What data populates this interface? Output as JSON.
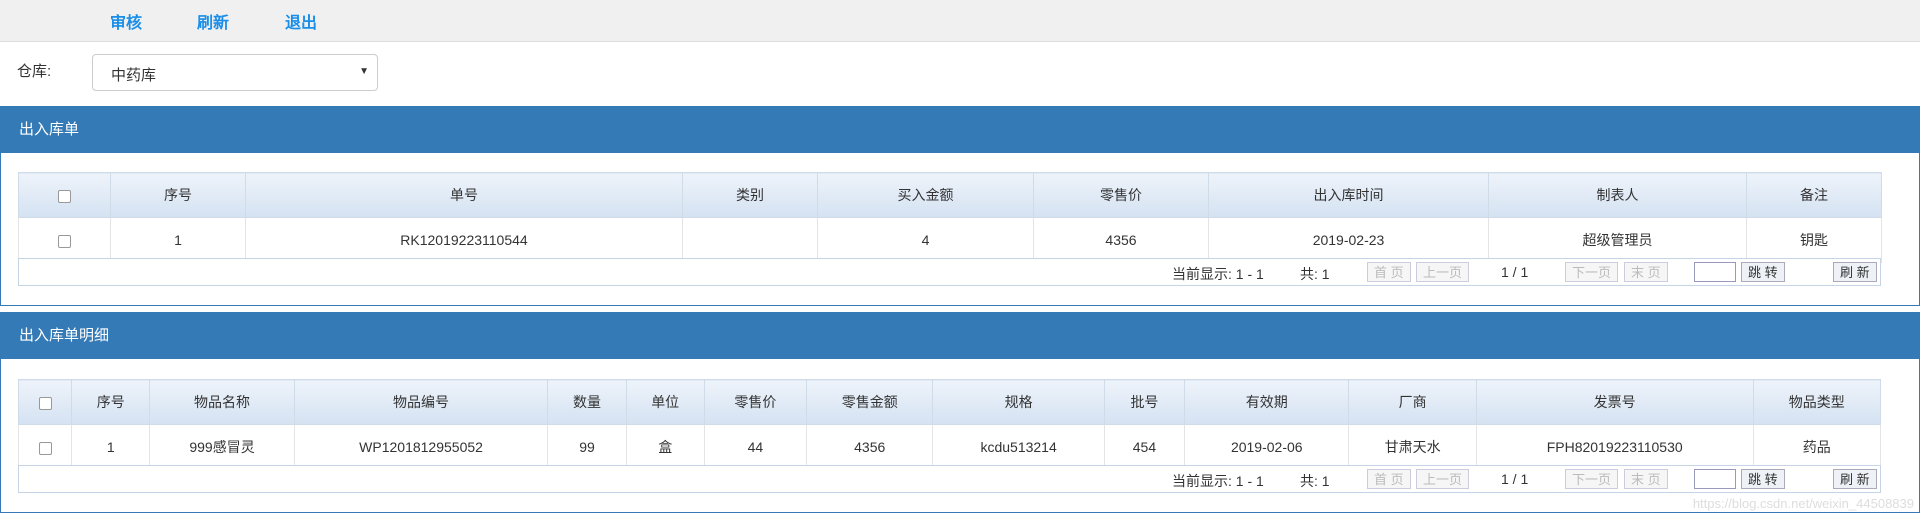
{
  "toolbar": {
    "audit": "审核",
    "refresh": "刷新",
    "exit": "退出"
  },
  "warehouse": {
    "label": "仓库:",
    "selected": "中药库"
  },
  "panel1": {
    "title": "出入库单",
    "headers": [
      "序号",
      "单号",
      "类别",
      "买入金额",
      "零售价",
      "出入库时间",
      "制表人",
      "备注"
    ],
    "row": {
      "index": "1",
      "order_no": "RK12019223110544",
      "category": "",
      "buy_amount": "4",
      "retail_price": "4356",
      "time": "2019-02-23",
      "maker": "超级管理员",
      "note": "钥匙"
    },
    "pager": {
      "showing": "当前显示: 1 - 1",
      "total": "共: 1",
      "first": "首 页",
      "prev": "上一页",
      "page": "1 / 1",
      "next": "下一页",
      "last": "末 页",
      "jump": "跳 转",
      "refresh": "刷 新"
    }
  },
  "panel2": {
    "title": "出入库单明细",
    "headers": [
      "序号",
      "物品名称",
      "物品编号",
      "数量",
      "单位",
      "零售价",
      "零售金额",
      "规格",
      "批号",
      "有效期",
      "厂商",
      "发票号",
      "物品类型"
    ],
    "row": {
      "index": "1",
      "name": "999感冒灵",
      "code": "WP1201812955052",
      "qty": "99",
      "unit": "盒",
      "retail_price": "44",
      "retail_amount": "4356",
      "spec": "kcdu513214",
      "batch": "454",
      "expiry": "2019-02-06",
      "maker": "甘肃天水",
      "invoice": "FPH82019223110530",
      "type": "药品"
    },
    "pager": {
      "showing": "当前显示: 1 - 1",
      "total": "共: 1",
      "first": "首 页",
      "prev": "上一页",
      "page": "1 / 1",
      "next": "下一页",
      "last": "末 页",
      "jump": "跳 转",
      "refresh": "刷 新"
    }
  },
  "watermark": "https://blog.csdn.net/weixin_44508839"
}
